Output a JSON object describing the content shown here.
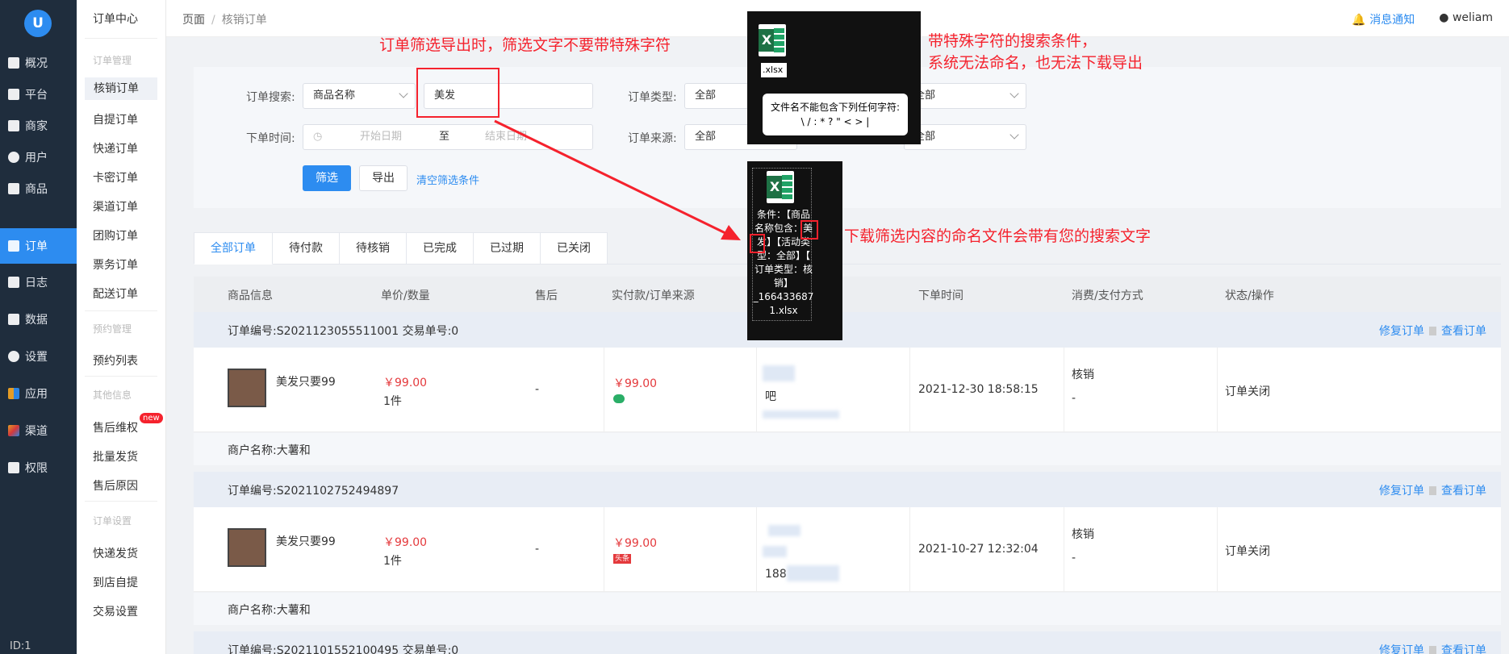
{
  "sidebar": {
    "logo": "U",
    "items": [
      {
        "label": "概况",
        "icon": "overview-icon"
      },
      {
        "label": "平台",
        "icon": "platform-icon"
      },
      {
        "label": "商家",
        "icon": "shop-icon"
      },
      {
        "label": "用户",
        "icon": "user-icon"
      },
      {
        "label": "商品",
        "icon": "goods-icon"
      },
      {
        "label": "订单",
        "icon": "order-icon"
      },
      {
        "label": "日志",
        "icon": "log-icon"
      },
      {
        "label": "数据",
        "icon": "chart-icon"
      },
      {
        "label": "设置",
        "icon": "gear-icon"
      },
      {
        "label": "应用",
        "icon": "apps-icon"
      },
      {
        "label": "渠道",
        "icon": "channel-icon"
      },
      {
        "label": "权限",
        "icon": "lock-icon"
      }
    ],
    "active": "订单",
    "footer_id": "ID:1"
  },
  "submenu": {
    "title": "订单中心",
    "sections": [
      {
        "header": "订单管理",
        "items": [
          "核销订单",
          "自提订单",
          "快递订单",
          "卡密订单",
          "渠道订单",
          "团购订单",
          "票务订单",
          "配送订单"
        ]
      },
      {
        "header": "预约管理",
        "items": [
          "预约列表"
        ]
      },
      {
        "header": "其他信息",
        "items": [
          "售后维权",
          "批量发货",
          "售后原因"
        ]
      },
      {
        "header": "订单设置",
        "items": [
          "快递发货",
          "到店自提",
          "交易设置"
        ]
      }
    ],
    "active": "核销订单",
    "new_badge": "new"
  },
  "topbar": {
    "breadcrumb": [
      "页面",
      "核销订单"
    ],
    "notice_label": "消息通知",
    "username": "weliam"
  },
  "filter": {
    "search_label": "订单搜索:",
    "search_field": "商品名称",
    "search_value": "美发",
    "order_type_label": "订单类型:",
    "order_type_value": "全部",
    "activity_type_value": "全部",
    "time_label": "下单时间:",
    "start_placeholder": "开始日期",
    "to_label": "至",
    "end_placeholder": "结束日期",
    "source_label": "订单来源:",
    "source_value": "全部",
    "extra_value": "全部",
    "filter_button": "筛选",
    "export_button": "导出",
    "clear_link": "清空筛选条件"
  },
  "tabs": [
    "全部订单",
    "待付款",
    "待核销",
    "已完成",
    "已过期",
    "已关闭"
  ],
  "table": {
    "columns": [
      "商品信息",
      "单价/数量",
      "售后",
      "实付款/订单来源",
      "",
      "下单时间",
      "消费/支付方式",
      "状态/操作"
    ],
    "repair_label": "修复订单",
    "view_label": "查看订单",
    "orders": [
      {
        "order_no": "订单编号:S2021123055511001   交易单号:0",
        "product": "美发只要99",
        "unit_price": "￥99.00",
        "qty": "1件",
        "after_sale": "-",
        "paid": "￥99.00",
        "source_icon": "wechat-icon",
        "buyer": "吧",
        "time": "2021-12-30 18:58:15",
        "consume": "核销",
        "pay": "-",
        "status": "订单关闭",
        "merchant": "商户名称:大薯和"
      },
      {
        "order_no": "订单编号:S2021102752494897",
        "product": "美发只要99",
        "unit_price": "￥99.00",
        "qty": "1件",
        "after_sale": "-",
        "paid": "￥99.00",
        "source_icon": "toutiao-icon",
        "source_badge": "头条",
        "buyer": "188",
        "time": "2021-10-27 12:32:04",
        "consume": "核销",
        "pay": "-",
        "status": "订单关闭",
        "merchant": "商户名称:大薯和"
      },
      {
        "order_no": "订单编号:S2021101552100495   交易单号:0"
      }
    ]
  },
  "annotations": {
    "top_note": "订单筛选导出时，筛选文字不要带特殊字符",
    "right_note_1": "带特殊字符的搜索条件，",
    "right_note_2": "系统无法命名，也无法下载导出",
    "arrow_note": "下载筛选内容的命名文件会带有您的搜索文字",
    "rename_text": ".xlsx",
    "tip_line1": "文件名不能包含下列任何字符:",
    "tip_line2": "\\ / : * ? \" < > |",
    "exported_filename": "条件：【商品\n名称包含：美\n发】【活动类\n型：全部】【\n订单类型：核\n销】\n_166433687\n1.xlsx",
    "colors": {
      "accent": "#2d8cf0",
      "annotation": "#f5222d",
      "sidebar": "#1f2d3d"
    }
  }
}
